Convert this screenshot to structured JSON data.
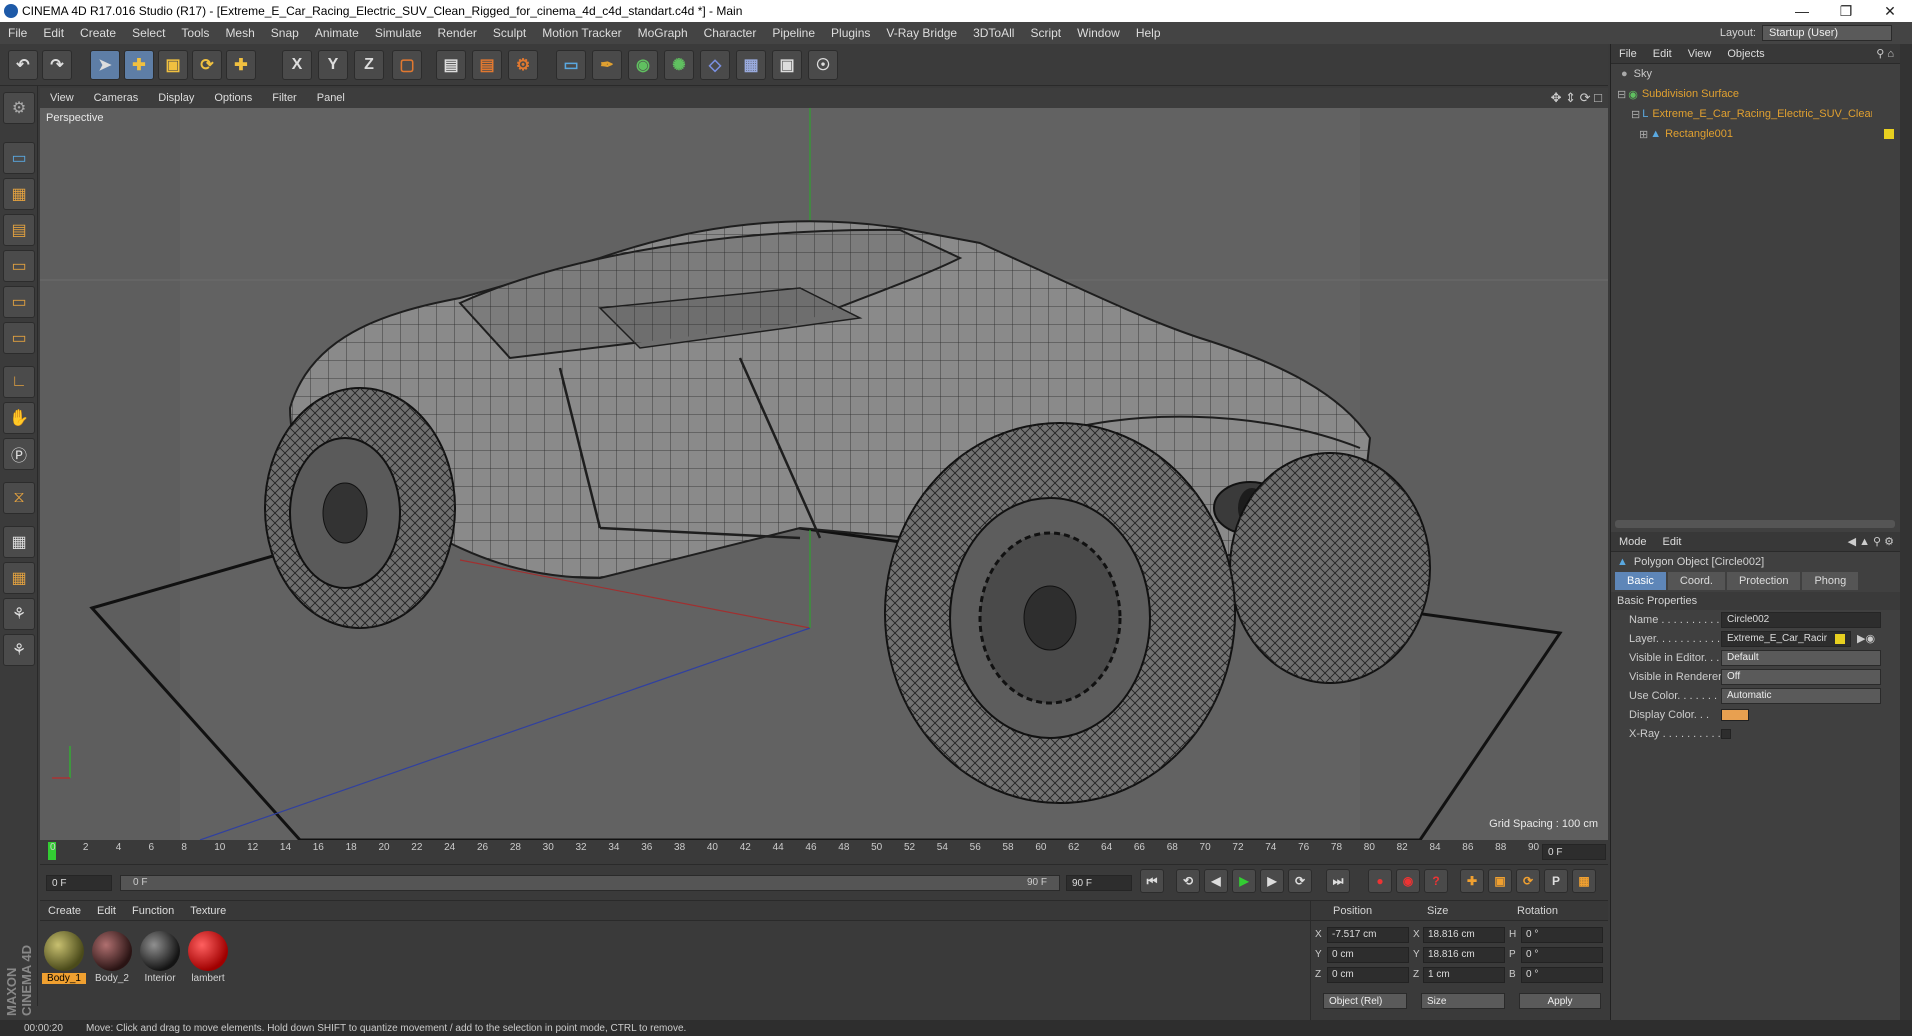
{
  "app": {
    "title": "CINEMA 4D R17.016 Studio (R17) - [Extreme_E_Car_Racing_Electric_SUV_Clean_Rigged_for_cinema_4d_c4d_standart.c4d *] - Main",
    "layout_label": "Layout:",
    "layout_value": "Startup (User)"
  },
  "menu": [
    "File",
    "Edit",
    "Create",
    "Select",
    "Tools",
    "Mesh",
    "Snap",
    "Animate",
    "Simulate",
    "Render",
    "Sculpt",
    "Motion Tracker",
    "MoGraph",
    "Character",
    "Pipeline",
    "Plugins",
    "V-Ray Bridge",
    "3DToAll",
    "Script",
    "Window",
    "Help"
  ],
  "toolbar": {
    "axis_x": "X",
    "axis_y": "Y",
    "axis_z": "Z"
  },
  "viewport": {
    "menus": [
      "View",
      "Cameras",
      "Display",
      "Options",
      "Filter",
      "Panel"
    ],
    "label": "Perspective",
    "grid_spacing": "Grid Spacing : 100 cm"
  },
  "timeline": {
    "ticks": [
      "0",
      "2",
      "4",
      "6",
      "8",
      "10",
      "12",
      "14",
      "16",
      "18",
      "20",
      "22",
      "24",
      "26",
      "28",
      "30",
      "32",
      "34",
      "36",
      "38",
      "40",
      "42",
      "44",
      "46",
      "48",
      "50",
      "52",
      "54",
      "56",
      "58",
      "60",
      "62",
      "64",
      "66",
      "68",
      "70",
      "72",
      "74",
      "76",
      "78",
      "80",
      "82",
      "84",
      "86",
      "88",
      "90"
    ],
    "current_frame": "0 F",
    "start_frame": "0 F",
    "range_start": "0 F",
    "range_end": "90 F",
    "end_frame": "90 F"
  },
  "materials": {
    "menus": [
      "Create",
      "Edit",
      "Function",
      "Texture"
    ],
    "items": [
      {
        "label": "Body_1",
        "color": "#6b6a2c"
      },
      {
        "label": "Body_2",
        "color": "#5a3232"
      },
      {
        "label": "Interior",
        "color": "#2a2a2a"
      },
      {
        "label": "lambert",
        "color": "#d01010"
      }
    ]
  },
  "coords": {
    "headers": [
      "Position",
      "Size",
      "Rotation"
    ],
    "rows": [
      {
        "axis": "X",
        "pos": "-7.517 cm",
        "size_axis": "X",
        "size": "18.816 cm",
        "rot_axis": "H",
        "rot": "0 °"
      },
      {
        "axis": "Y",
        "pos": "0 cm",
        "size_axis": "Y",
        "size": "18.816 cm",
        "rot_axis": "P",
        "rot": "0 °"
      },
      {
        "axis": "Z",
        "pos": "0 cm",
        "size_axis": "Z",
        "size": "1 cm",
        "rot_axis": "B",
        "rot": "0 °"
      }
    ],
    "mode": "Object (Rel)",
    "size_mode": "Size",
    "apply": "Apply"
  },
  "object_manager": {
    "menus": [
      "File",
      "Edit",
      "View",
      "Objects"
    ],
    "objects": [
      {
        "name": "Sky",
        "color": "#c8c8c8"
      },
      {
        "name": "Subdivision Surface",
        "color": "#e0a030"
      },
      {
        "name": "Extreme_E_Car_Racing_Electric_SUV_Clean",
        "color": "#e0a030"
      },
      {
        "name": "Rectangle001",
        "color": "#e0a030"
      }
    ]
  },
  "attributes": {
    "menus": [
      "Mode",
      "Edit"
    ],
    "object_title": "Polygon Object [Circle002]",
    "tabs": [
      "Basic",
      "Coord.",
      "Protection",
      "Phong"
    ],
    "section": "Basic Properties",
    "props": [
      {
        "label": "Name . . . . . . . . . . . .",
        "value": "Circle002"
      },
      {
        "label": "Layer. . . . . . . . . . . . .",
        "value": "Extreme_E_Car_Racir"
      },
      {
        "label": "Visible in Editor. . .",
        "value": "Default"
      },
      {
        "label": "Visible in Renderer",
        "value": "Off"
      },
      {
        "label": "Use Color. . . . . . . .",
        "value": "Automatic"
      },
      {
        "label": "Display Color. . .",
        "value": ""
      },
      {
        "label": "X-Ray . . . . . . . . . . .",
        "value": ""
      }
    ],
    "display_color": "#e8a050"
  },
  "status": {
    "time": "00:00:20",
    "message": "Move: Click and drag to move elements. Hold down SHIFT to quantize movement / add to the selection in point mode, CTRL to remove."
  },
  "brand": "MAXON CINEMA 4D"
}
